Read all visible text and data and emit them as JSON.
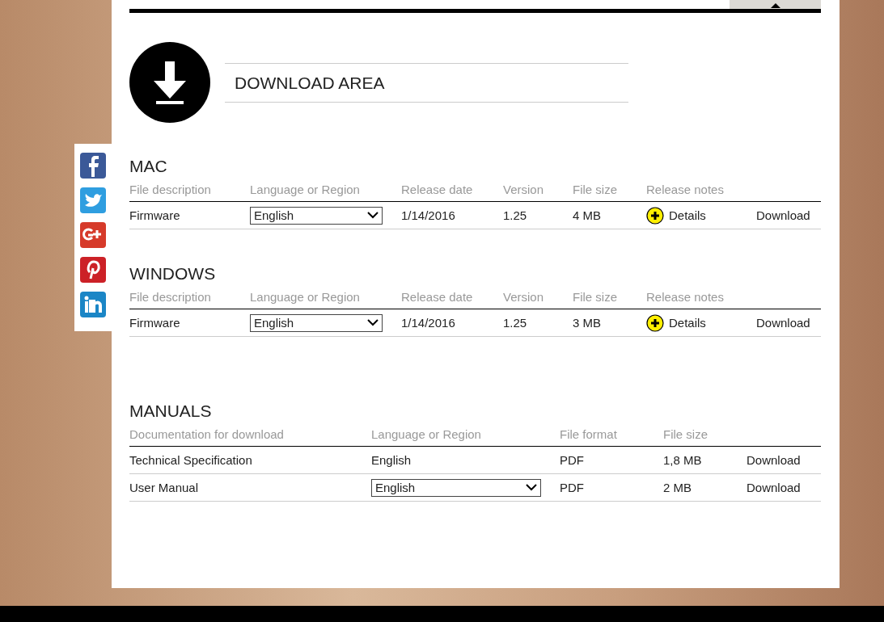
{
  "header": {
    "title": "DOWNLOAD AREA"
  },
  "software_sections": [
    {
      "title": "MAC",
      "columns": [
        "File description",
        "Language or Region",
        "Release date",
        "Version",
        "File size",
        "Release notes"
      ],
      "rows": [
        {
          "description": "Firmware",
          "language": "English",
          "release_date": "1/14/2016",
          "version": "1.25",
          "file_size": "4 MB",
          "notes_link": "Details",
          "download": "Download"
        }
      ]
    },
    {
      "title": "WINDOWS",
      "columns": [
        "File description",
        "Language or Region",
        "Release date",
        "Version",
        "File size",
        "Release notes"
      ],
      "rows": [
        {
          "description": "Firmware",
          "language": "English",
          "release_date": "1/14/2016",
          "version": "1.25",
          "file_size": "3 MB",
          "notes_link": "Details",
          "download": "Download"
        }
      ]
    }
  ],
  "manuals": {
    "title": "MANUALS",
    "columns": [
      "Documentation for download",
      "Language or Region",
      "File format",
      "File size"
    ],
    "rows": [
      {
        "description": "Technical Specification",
        "language": {
          "kind": "text",
          "value": "English"
        },
        "format": "PDF",
        "file_size": "1,8 MB",
        "download": "Download"
      },
      {
        "description": "User Manual",
        "language": {
          "kind": "dropdown",
          "value": "English"
        },
        "format": "PDF",
        "file_size": "2 MB",
        "download": "Download"
      }
    ]
  }
}
